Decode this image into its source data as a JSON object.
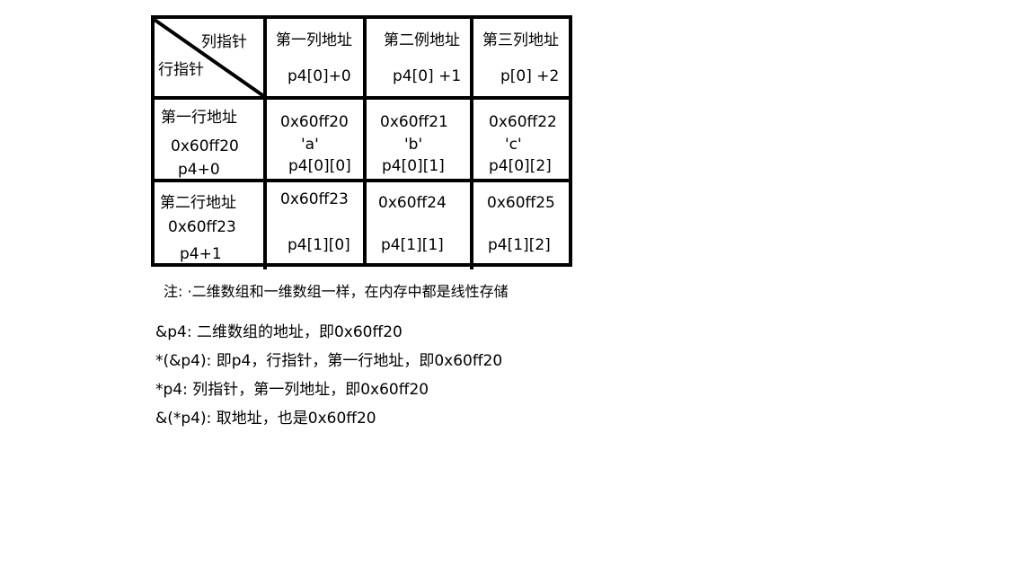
{
  "table": {
    "corner": {
      "col_label": "列指针",
      "row_label": "行指针"
    },
    "col_headers": [
      {
        "title": "第一列地址",
        "expr": "p4[0]+0"
      },
      {
        "title": "第二例地址",
        "expr": "p4[0] +1"
      },
      {
        "title": "第三列地址",
        "expr": "p[0] +2"
      }
    ],
    "rows": [
      {
        "title": "第一行地址",
        "addr": "0x60ff20",
        "expr": "p4+0",
        "cells": [
          {
            "addr": "0x60ff20",
            "value": "'a'",
            "expr": "p4[0][0]"
          },
          {
            "addr": "0x60ff21",
            "value": "'b'",
            "expr": "p4[0][1]"
          },
          {
            "addr": "0x60ff22",
            "value": "'c'",
            "expr": "p4[0][2]"
          }
        ]
      },
      {
        "title": "第二行地址",
        "addr": "0x60ff23",
        "expr": "p4+1",
        "cells": [
          {
            "addr": "0x60ff23",
            "expr": "p4[1][0]"
          },
          {
            "addr": "0x60ff24",
            "expr": "p4[1][1]"
          },
          {
            "addr": "0x60ff25",
            "expr": "p4[1][2]"
          }
        ]
      }
    ]
  },
  "note": "注: ·二维数组和一维数组一样，在内存中都是线性存储",
  "explanations": [
    "&p4: 二维数组的地址，即0x60ff20",
    "*(&p4): 即p4，行指针，第一行地址，即0x60ff20",
    "*p4:  列指针，第一列地址，即0x60ff20",
    "&(*p4): 取地址，也是0x60ff20"
  ]
}
